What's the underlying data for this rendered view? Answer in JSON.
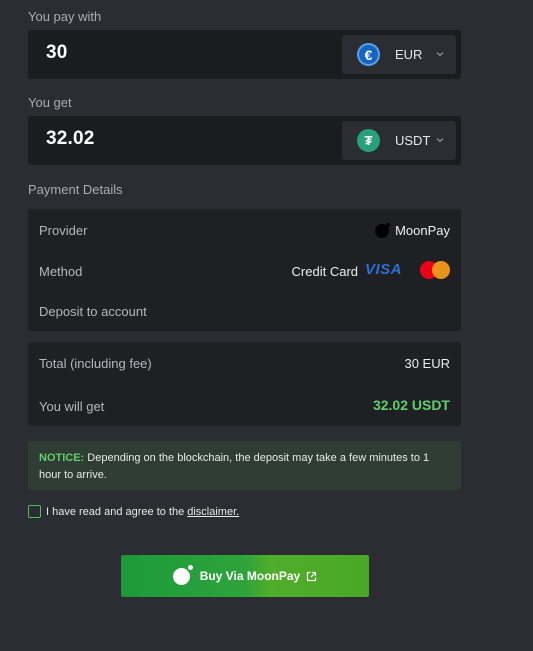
{
  "pay": {
    "label": "You pay with",
    "amount": "30",
    "currency": "EUR",
    "currency_icon": "euro-icon",
    "currency_symbol": "€"
  },
  "get": {
    "label": "You get",
    "amount": "32.02",
    "currency": "USDT",
    "currency_icon": "tether-icon",
    "currency_symbol": "₮"
  },
  "payment_details": {
    "title": "Payment Details",
    "provider_label": "Provider",
    "provider_value": "MoonPay",
    "method_label": "Method",
    "method_value": "Credit Card",
    "visa_text": "VISA",
    "deposit_label": "Deposit to account"
  },
  "summary": {
    "total_label": "Total (including fee)",
    "total_value": "30 EUR",
    "receive_label": "You will get",
    "receive_value": "32.02 USDT"
  },
  "notice": {
    "title": "NOTICE:",
    "text": " Depending on the blockchain, the deposit may take a few minutes to 1 hour to arrive."
  },
  "agreement": {
    "text": "I have read and agree to the",
    "link": "disclaimer."
  },
  "button": {
    "label": "Buy Via MoonPay"
  },
  "colors": {
    "background": "#2b2d33",
    "accent_green": "#5fd06a",
    "button_green": "#2ea33b",
    "euro_blue": "#1565c0",
    "tether_green": "#26a17b"
  }
}
